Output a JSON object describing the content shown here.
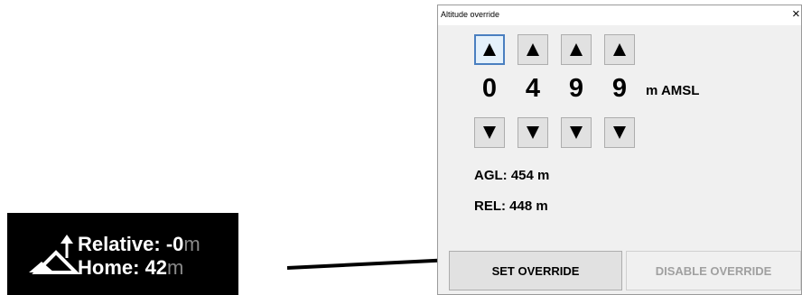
{
  "overlay": {
    "relative_label": "Relative: ",
    "relative_value": "-0",
    "relative_unit": "m",
    "home_label": "Home: ",
    "home_value": "42",
    "home_unit": "m",
    "icon": "altitude-mountain-arrow-icon"
  },
  "dialog": {
    "title": "Altitude override",
    "close_glyph": "×",
    "digits": [
      "0",
      "4",
      "9",
      "9"
    ],
    "unit": "m AMSL",
    "agl": "AGL: 454 m",
    "rel": "REL: 448 m",
    "set_override_label": "SET OVERRIDE",
    "disable_override_label": "DISABLE OVERRIDE",
    "disable_override_enabled": false
  },
  "colors": {
    "overlay_bg": "#000000",
    "overlay_text": "#ffffff",
    "overlay_unit": "#8a8a8a",
    "dialog_bg": "#f0f0f0",
    "button_bg": "#e1e1e1",
    "focus_border": "#4a7fc0",
    "disabled_text": "#a0a0a0"
  }
}
